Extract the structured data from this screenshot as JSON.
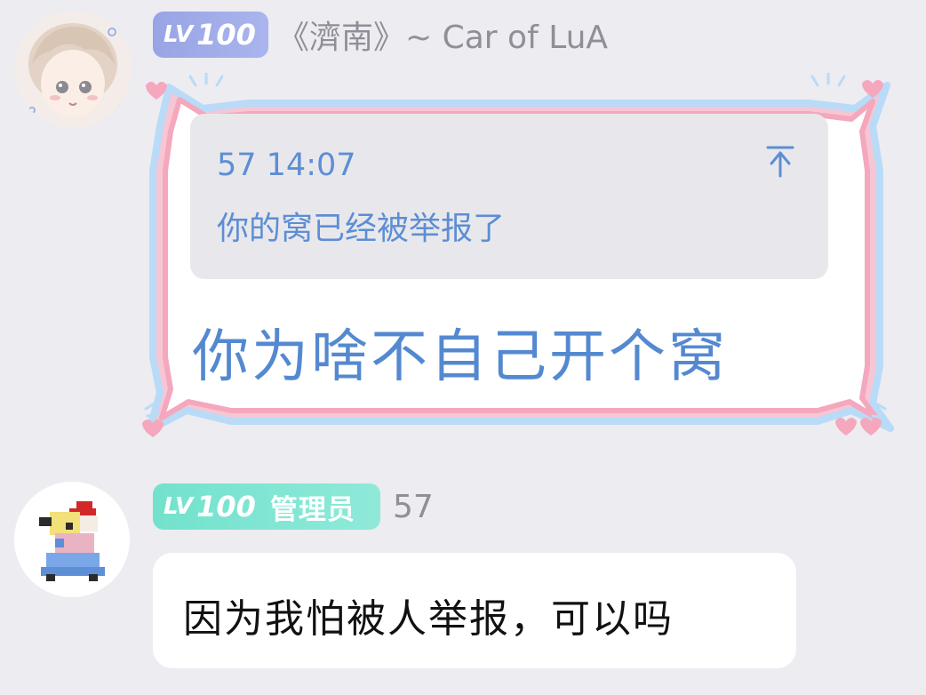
{
  "messages": [
    {
      "level_prefix": "LV",
      "level_number": "100",
      "username": "《濟南》~ Car of LuA",
      "avatar_icon": "anime-boy-avatar",
      "bubble_style": "decorated-frame",
      "quote": {
        "meta": "57 14:07",
        "text": "你的窝已经被举报了",
        "jump_icon": "jump-to-top-icon"
      },
      "text": "你为啥不自己开个窝"
    },
    {
      "level_prefix": "LV",
      "level_number": "100",
      "role": "管理员",
      "username": "57",
      "avatar_icon": "pixel-character-avatar",
      "bubble_style": "plain",
      "text": "因为我怕被人举报，可以吗"
    }
  ],
  "colors": {
    "background": "#ececf1",
    "badge_level_1": "#98a4e4",
    "badge_admin": "#72e2cc",
    "quote_text": "#5d8ed4",
    "big_text": "#5489d0",
    "frame_pink": "#f4a7bd",
    "frame_blue": "#b8d8f6"
  }
}
